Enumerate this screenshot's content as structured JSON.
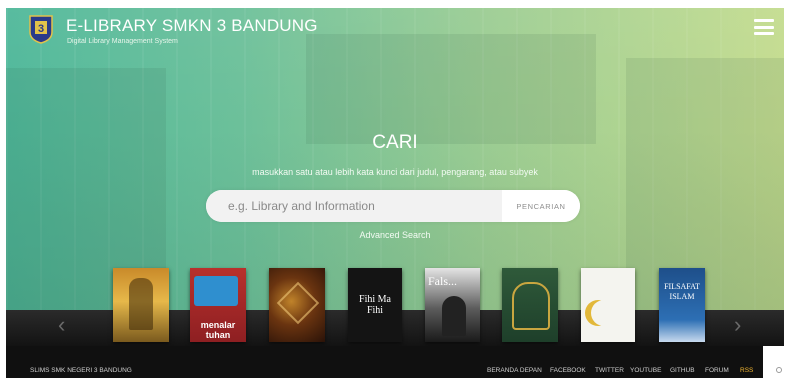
{
  "header": {
    "logo_number": "3",
    "title": "E-LIBRARY SMKN 3 BANDUNG",
    "subtitle": "Digital Library Management System"
  },
  "search": {
    "heading": "CARI",
    "hint": "masukkan satu atau lebih kata kunci dari judul, pengarang, atau subyek",
    "placeholder": "e.g. Library and Information",
    "button_label": "PENCARIAN",
    "advanced_label": "Advanced Search"
  },
  "books": [
    {
      "name": "book-cover-1",
      "cover_text": ""
    },
    {
      "name": "book-cover-2",
      "cover_text": "menalar tuhan"
    },
    {
      "name": "book-cover-3",
      "cover_text": ""
    },
    {
      "name": "book-cover-fihi-ma-fihi",
      "cover_text": "Fihi Ma Fihi"
    },
    {
      "name": "book-cover-5",
      "cover_text": "Fals..."
    },
    {
      "name": "book-cover-6",
      "cover_text": ""
    },
    {
      "name": "book-cover-7",
      "cover_text": ""
    },
    {
      "name": "book-cover-8",
      "cover_text": "FILSAFAT ISLAM"
    }
  ],
  "footer": {
    "left_text": "SLIMS SMK NEGERI 3 BANDUNG",
    "links": [
      "BERANDA DEPAN",
      "FACEBOOK",
      "TWITTER",
      "YOUTUBE",
      "GITHUB",
      "FORUM",
      "RSS"
    ]
  },
  "colors": {
    "hero_gradient_start": "#4fb89a",
    "hero_gradient_end": "#c4dc8f",
    "footer_bg": "#101010",
    "rss": "#f2b632"
  }
}
